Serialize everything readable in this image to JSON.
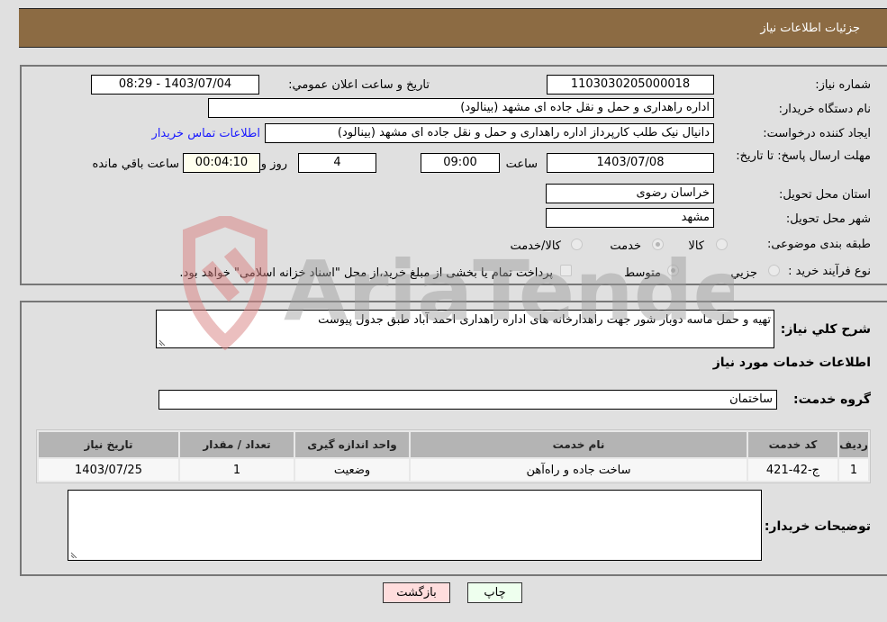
{
  "header": {
    "title": "جزئیات اطلاعات نیاز"
  },
  "details": {
    "need_number_label": "شماره نیاز:",
    "need_number": "1103030205000018",
    "announce_label": "تاریخ و ساعت اعلان عمومي:",
    "announce_value": "1403/07/04 - 08:29",
    "buyer_org_label": "نام دستگاه خریدار:",
    "buyer_org": "اداره راهداری و حمل و نقل جاده ای مشهد (بینالود)",
    "creator_label": "ایجاد کننده درخواست:",
    "creator": "دانیال نیک طلب کارپرداز اداره راهداری و حمل و نقل جاده ای مشهد (بینالود)",
    "contact_link": "اطلاعات تماس خریدار",
    "deadline_label": "مهلت ارسال پاسخ: تا تاریخ:",
    "deadline_date": "1403/07/08",
    "time_label": "ساعت",
    "deadline_time": "09:00",
    "days_value": "4",
    "days_label": "روز و",
    "remaining_time": "00:04:10",
    "remaining_label": "ساعت باقي مانده",
    "province_label": "استان محل تحویل:",
    "province": "خراسان رضوی",
    "city_label": "شهر محل تحویل:",
    "city": "مشهد",
    "category_label": "طبقه بندی موضوعی:",
    "category_options": [
      {
        "label": "کالا",
        "selected": false
      },
      {
        "label": "خدمت",
        "selected": true
      },
      {
        "label": "کالا/خدمت",
        "selected": false
      }
    ],
    "process_label": "نوع فرآیند خرید :",
    "process_options": [
      {
        "label": "جزيي",
        "selected": false
      },
      {
        "label": "متوسط",
        "selected": true
      }
    ],
    "treasury_note": "پرداخت تمام یا بخشی از مبلغ خرید،از محل \"اسناد خزانه اسلامی\" خواهد بود.",
    "treasury_checked": false
  },
  "services": {
    "description_label": "شرح کلي نیاز:",
    "description": "تهیه و حمل ماسه دوبار شور جهت راهدارخانه های اداره راهداری احمد آباد طبق جدول پیوست",
    "section_title": "اطلاعات خدمات مورد نیاز",
    "group_label": "گروه خدمت:",
    "group_value": "ساختمان",
    "table": {
      "headers": [
        "ردیف",
        "کد خدمت",
        "نام خدمت",
        "واحد اندازه گیری",
        "تعداد / مقدار",
        "تاریخ نیاز"
      ],
      "rows": [
        [
          "1",
          "ج-42-421",
          "ساخت جاده و راه‌آهن",
          "وضعیت",
          "1",
          "1403/07/25"
        ]
      ]
    },
    "buyer_notes_label": "توضیحات خریدار:",
    "buyer_notes": ""
  },
  "buttons": {
    "print": "چاپ",
    "back": "بازگشت"
  },
  "watermark": {
    "text": "AriaTender.neT"
  },
  "colors": {
    "header": "#8c6b43",
    "print_bg": "#eeffee",
    "back_bg": "#ffdddd",
    "link": "#1a1aff"
  }
}
